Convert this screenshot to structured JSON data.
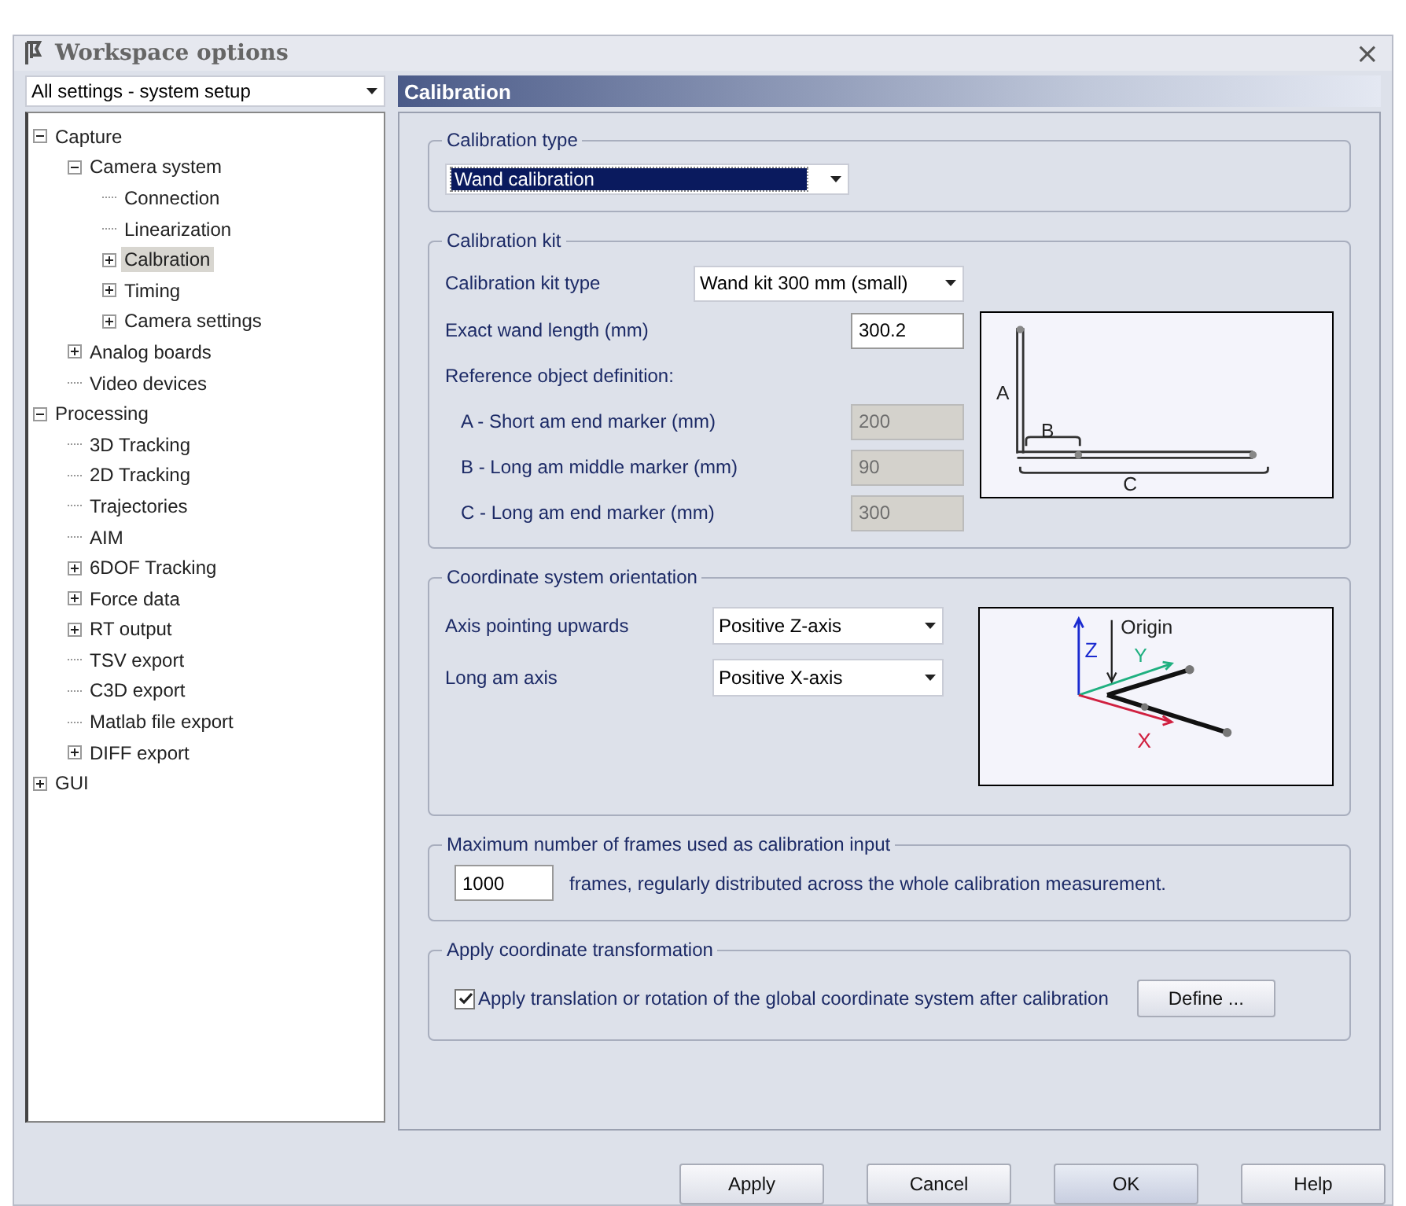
{
  "window": {
    "title": "Workspace options",
    "close": "×"
  },
  "settings_scope": {
    "value": "All settings - system setup"
  },
  "tree": [
    {
      "label": "Capture",
      "expanded": true,
      "selected": false,
      "children": [
        {
          "label": "Camera system",
          "expanded": true,
          "selected": false,
          "children": [
            {
              "label": "Connection",
              "selected": false
            },
            {
              "label": "Linearization",
              "selected": false
            },
            {
              "label": "Calbration",
              "expanded": false,
              "selected": true
            },
            {
              "label": "Timing",
              "expanded": false,
              "selected": false
            },
            {
              "label": "Camera settings",
              "expanded": false,
              "selected": false
            }
          ]
        },
        {
          "label": "Analog boards",
          "expanded": false,
          "selected": false
        },
        {
          "label": "Video devices",
          "selected": false
        }
      ]
    },
    {
      "label": "Processing",
      "expanded": true,
      "selected": false,
      "children": [
        {
          "label": "3D Tracking",
          "selected": false
        },
        {
          "label": "2D Tracking",
          "selected": false
        },
        {
          "label": "Trajectories",
          "selected": false
        },
        {
          "label": "AIM",
          "selected": false
        },
        {
          "label": "6DOF Tracking",
          "expanded": false,
          "selected": false
        },
        {
          "label": "Force data",
          "expanded": false,
          "selected": false
        },
        {
          "label": "RT output",
          "expanded": false,
          "selected": false
        },
        {
          "label": "TSV export",
          "selected": false
        },
        {
          "label": "C3D export",
          "selected": false
        },
        {
          "label": "Matlab file export",
          "selected": false
        },
        {
          "label": "DIFF export",
          "expanded": false,
          "selected": false
        }
      ]
    },
    {
      "label": "GUI",
      "expanded": false,
      "selected": false
    }
  ],
  "panel": {
    "title": "Calibration",
    "calibration_type": {
      "legend": "Calibration type",
      "value": "Wand calibration",
      "focused": true
    },
    "calibration_kit": {
      "legend": "Calibration kit",
      "kit_type_label": "Calibration kit type",
      "kit_type_value": "Wand kit 300 mm (small)",
      "wand_length_label": "Exact wand length (mm)",
      "wand_length_value": "300.2",
      "reference_heading": "Reference object definition:",
      "markers": [
        {
          "label": "A - Short am end marker (mm)",
          "value": "200",
          "disabled": true
        },
        {
          "label": "B - Long am middle marker (mm)",
          "value": "90",
          "disabled": true
        },
        {
          "label": "C - Long am end marker (mm)",
          "value": "300",
          "disabled": true
        }
      ],
      "diagram_labels": [
        "A",
        "B",
        "C"
      ]
    },
    "orientation": {
      "legend": "Coordinate system orientation",
      "rows": [
        {
          "label": "Axis pointing upwards",
          "value": "Positive Z-axis"
        },
        {
          "label": "Long am axis",
          "value": "Positive X-axis"
        }
      ],
      "diagram_labels": {
        "origin": "Origin",
        "z": "Z",
        "y": "Y",
        "x": "X"
      }
    },
    "max_frames": {
      "legend": "Maximum number of frames used as calibration input",
      "value": "1000",
      "note": "frames, regularly distributed across the whole calibration measurement."
    },
    "transformation": {
      "legend": "Apply coordinate transformation",
      "checkbox_label": "Apply translation or rotation of the global coordinate system after calibration",
      "checked": true,
      "button": "Define ..."
    }
  },
  "buttons": [
    {
      "label": "Apply",
      "default": false
    },
    {
      "label": "Cancel",
      "default": false
    },
    {
      "label": "OK",
      "default": true
    },
    {
      "label": "Help",
      "default": false
    }
  ]
}
